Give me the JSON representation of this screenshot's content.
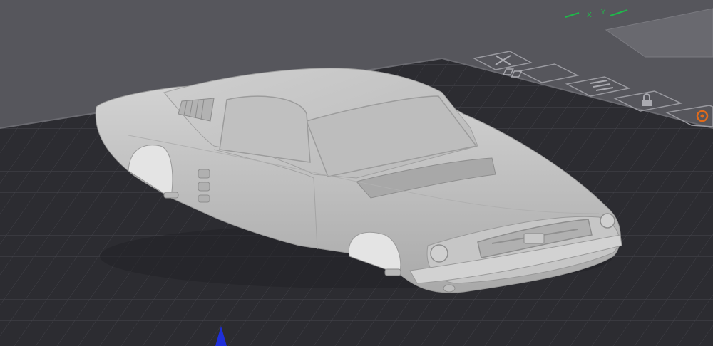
{
  "viewport": {
    "background": "#56565c",
    "bed_color": "#2c2c31",
    "grid_color": "#44444b",
    "model_color": "#c4c4c4"
  },
  "axis_gizmo": {
    "x_axis_color": "#1fb84a",
    "y_axis_color": "#1fb84a",
    "z_axis_color": "#1f2fd8",
    "x_label": "X",
    "y_label": "Y"
  },
  "bed_labels": [
    {
      "icon": "close-icon"
    },
    {
      "icon": "auto-arrange-icon"
    },
    {
      "icon": "plate-settings-icon"
    },
    {
      "icon": "lock-icon"
    },
    {
      "icon": "orient-icon",
      "accent": "#e06a1a"
    }
  ],
  "model": {
    "name": "fastback-car-body",
    "selected": false
  }
}
